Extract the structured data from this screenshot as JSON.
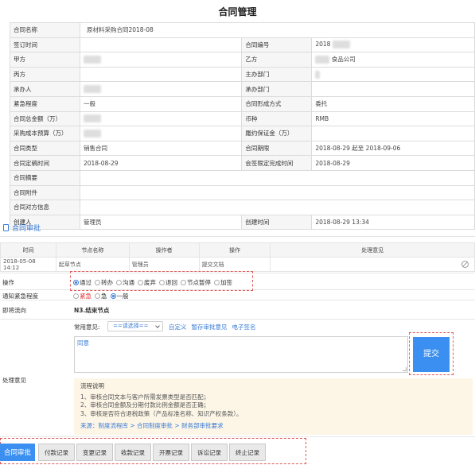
{
  "page_title": "合同管理",
  "contract_info": {
    "contract_name_label": "合同名称",
    "contract_name_value": "原材料采购合同2018-08",
    "sign_time_label": "签订时间",
    "contract_no_label": "合同编号",
    "contract_no_value": "2018",
    "party_a_label": "甲方",
    "party_b_label": "乙方",
    "party_b_value": "食品公司",
    "party_c_label": "丙方",
    "host_dept_label": "主办部门",
    "undertaker_label": "承办人",
    "undertake_dept_label": "承办部门",
    "urgency_label": "紧急程度",
    "urgency_value": "一般",
    "formation_label": "合同形成方式",
    "formation_value": "委托",
    "total_amount_label": "合同总金额（万）",
    "currency_label": "币种",
    "currency_value": "RMB",
    "budget_label": "采购成本预算（万）",
    "deposit_label": "履约保证金（万）",
    "type_label": "合同类型",
    "type_value": "销售合同",
    "period_label": "合同期限",
    "period_value": "2018-08-29 起至 2018-09-06",
    "finalize_label": "合同定稿时间",
    "finalize_value": "2018-08-29",
    "countersign_label": "会签限定完成时间",
    "countersign_value": "2018-08-29",
    "summary_label": "合同摘要",
    "attachment_label": "合同附件",
    "counterparty_label": "合同对方信息",
    "creator_label": "创建人",
    "creator_value": "管理员",
    "create_time_label": "创建时间",
    "create_time_value": "2018-08-29 13:34"
  },
  "approval": {
    "section_title": "合同审批",
    "history_headers": [
      "时间",
      "节点名称",
      "操作者",
      "操作",
      "处理意见"
    ],
    "history_rows": [
      {
        "time": "2018-05-08 14:12",
        "node": "起草节点",
        "operator": "管理员",
        "action": "提交文档",
        "opinion": ""
      }
    ],
    "operation_label": "操作",
    "operations": [
      "通过",
      "转办",
      "沟通",
      "废弃",
      "退回",
      "节点暂停",
      "加签"
    ],
    "operation_selected": "通过",
    "notify_label": "通知紧急程度",
    "urgency_options": [
      "紧急",
      "急",
      "一般"
    ],
    "urgency_selected": "一般",
    "next_flow_label": "即将流向",
    "next_flow_value": "N3.结束节点",
    "opinion_label": "处理意见",
    "common_opinion_label": "常用意见:",
    "select_placeholder": "==请选择==",
    "links": [
      "自定义",
      "暂存审批意见",
      "电子签名"
    ],
    "opinion_text": "同意",
    "submit_label": "提交",
    "flow_desc_title": "流程说明",
    "flow_desc_items": [
      "1、审核合同文本与客户所需发票类型是否匹配；",
      "2、审核合同金额及分期付款比例金额是否正确；",
      "3、审核是否符合退税政策（产品标准名称、知识产权条款）。"
    ],
    "flow_source": "来源：制度流程库 > 合同制度审批 > 财务部审批要求"
  },
  "bottom_tabs": [
    "合同审批",
    "付款记录",
    "变更记录",
    "收款记录",
    "开票记录",
    "诉讼记录",
    "终止记录"
  ],
  "colors": {
    "accent": "#3b8ff0",
    "dashed_highlight": "#e05a5a",
    "urgent": "#e03030"
  }
}
